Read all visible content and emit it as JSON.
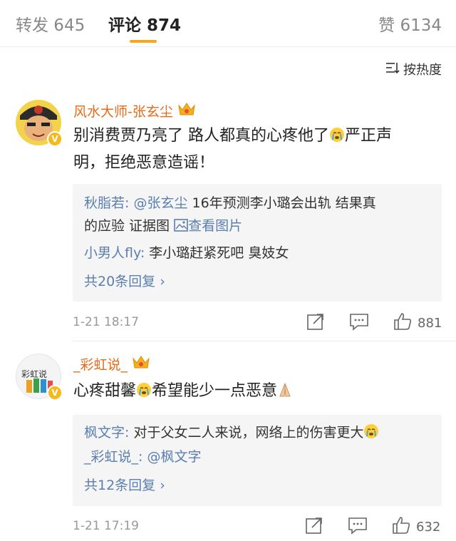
{
  "tabs": {
    "repost": "转发 645",
    "comment": "评论 874",
    "like": "赞 6134"
  },
  "sort": {
    "label": "按热度"
  },
  "comments": [
    {
      "username": "风水大师-张玄尘",
      "text_a": "别消费贾乃亮了 路人都真的心疼他了",
      "text_b": "严正声",
      "text_c": "明，拒绝恶意造谣！",
      "replies": [
        {
          "name": "秋脂若:",
          "mention": "@张玄尘",
          "text": " 16年预测李小璐会出轨 结果真",
          "text2": "的应验 证据图 ",
          "link": "查看图片"
        },
        {
          "name": "小男人fly:",
          "text": " 李小璐赶紧死吧 臭妓女"
        }
      ],
      "more": "共20条回复 ›",
      "time": "1-21 18:17",
      "likes": "881"
    },
    {
      "username": "_彩虹说_",
      "avatar_text": "彩虹说",
      "text_a": "心疼甜馨",
      "text_b": "希望能少一点恶意",
      "replies": [
        {
          "name": "枫文字:",
          "text": " 对于父女二人来说，网络上的伤害更大"
        },
        {
          "name": "_彩虹说_:",
          "mention": " @枫文字"
        }
      ],
      "more": "共12条回复 ›",
      "time": "1-21 17:19",
      "likes": "632"
    }
  ],
  "colors": {
    "accent": "#f5a623",
    "username": "#e86b1a",
    "link": "#5a7fb0"
  }
}
